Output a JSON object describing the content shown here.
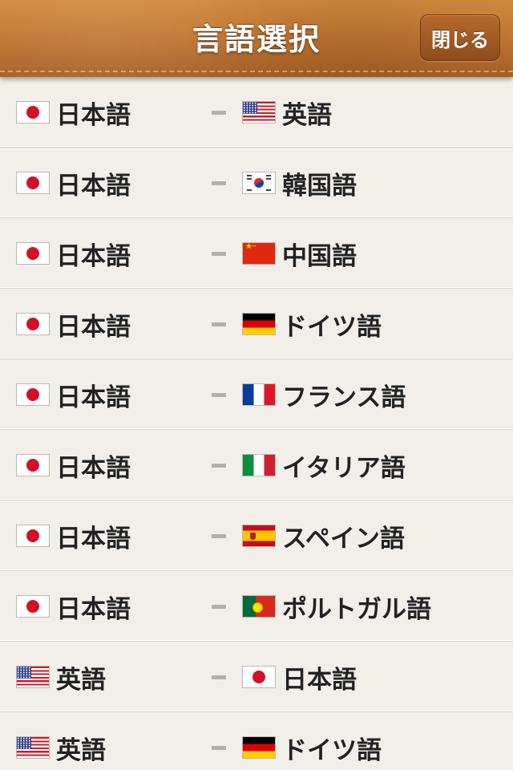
{
  "header": {
    "title": "言語選択",
    "close_label": "閉じる"
  },
  "rows": [
    {
      "from": {
        "label": "日本語",
        "flag": "jp"
      },
      "to": {
        "label": "英語",
        "flag": "us"
      }
    },
    {
      "from": {
        "label": "日本語",
        "flag": "jp"
      },
      "to": {
        "label": "韓国語",
        "flag": "kr"
      }
    },
    {
      "from": {
        "label": "日本語",
        "flag": "jp"
      },
      "to": {
        "label": "中国語",
        "flag": "cn"
      }
    },
    {
      "from": {
        "label": "日本語",
        "flag": "jp"
      },
      "to": {
        "label": "ドイツ語",
        "flag": "de"
      }
    },
    {
      "from": {
        "label": "日本語",
        "flag": "jp"
      },
      "to": {
        "label": "フランス語",
        "flag": "fr"
      }
    },
    {
      "from": {
        "label": "日本語",
        "flag": "jp"
      },
      "to": {
        "label": "イタリア語",
        "flag": "it"
      }
    },
    {
      "from": {
        "label": "日本語",
        "flag": "jp"
      },
      "to": {
        "label": "スペイン語",
        "flag": "es"
      }
    },
    {
      "from": {
        "label": "日本語",
        "flag": "jp"
      },
      "to": {
        "label": "ポルトガル語",
        "flag": "pt"
      }
    },
    {
      "from": {
        "label": "英語",
        "flag": "us"
      },
      "to": {
        "label": "日本語",
        "flag": "jp"
      }
    },
    {
      "from": {
        "label": "英語",
        "flag": "us"
      },
      "to": {
        "label": "ドイツ語",
        "flag": "de"
      }
    }
  ],
  "colors": {
    "header_leather": "#c07632",
    "row_background": "#f2efea",
    "separator_dash": "#b3aea8"
  }
}
